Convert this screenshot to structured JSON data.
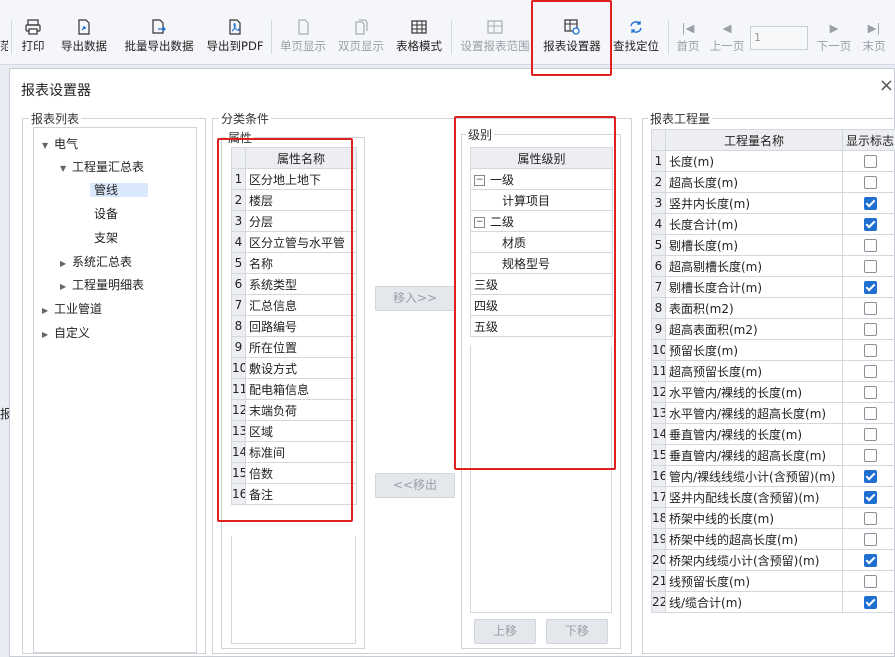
{
  "toolbar": {
    "partial_left": "范",
    "print": "打印",
    "export_data": "导出数据",
    "batch_export": "批量导出数据",
    "export_pdf": "导出到PDF",
    "single_page": "单页显示",
    "double_page": "双页显示",
    "table_mode": "表格模式",
    "set_range": "设置报表范围",
    "report_settings": "报表设置器",
    "find_locate": "查找定位",
    "first_page": "首页",
    "prev_page": "上一页",
    "page_value": "1",
    "next_page": "下一页",
    "last_page": "末页"
  },
  "dialog": {
    "title": "报表设置器",
    "close": "×",
    "side_char": "报"
  },
  "report_list": {
    "title": "报表列表",
    "nodes": [
      {
        "label": "电气"
      },
      {
        "label": "工程量汇总表"
      },
      {
        "label": "管线"
      },
      {
        "label": "设备"
      },
      {
        "label": "支架"
      },
      {
        "label": "系统汇总表"
      },
      {
        "label": "工程量明细表"
      },
      {
        "label": "工业管道"
      },
      {
        "label": "自定义"
      }
    ]
  },
  "classification": {
    "title": "分类条件",
    "attr_title": "属性",
    "attr_header": "属性名称",
    "attributes": [
      "区分地上地下",
      "楼层",
      "分层",
      "区分立管与水平管",
      "名称",
      "系统类型",
      "汇总信息",
      "回路编号",
      "所在位置",
      "敷设方式",
      "配电箱信息",
      "末端负荷",
      "区域",
      "标准间",
      "倍数",
      "备注"
    ],
    "move_in": "移入>>",
    "move_out": "<<移出",
    "level_title": "级别",
    "level_header": "属性级别",
    "levels": [
      {
        "label": "一级"
      },
      {
        "label": "计算项目"
      },
      {
        "label": "二级"
      },
      {
        "label": "材质"
      },
      {
        "label": "规格型号"
      },
      {
        "label": "三级"
      },
      {
        "label": "四级"
      },
      {
        "label": "五级"
      }
    ],
    "move_up": "上移",
    "move_down": "下移"
  },
  "quantities": {
    "title": "报表工程量",
    "col_name": "工程量名称",
    "col_show": "显示标志",
    "rows": [
      {
        "name": "长度(m)",
        "checked": false
      },
      {
        "name": "超高长度(m)",
        "checked": false
      },
      {
        "name": "竖井内长度(m)",
        "checked": true
      },
      {
        "name": "长度合计(m)",
        "checked": true
      },
      {
        "name": "剔槽长度(m)",
        "checked": false
      },
      {
        "name": "超高剔槽长度(m)",
        "checked": false
      },
      {
        "name": "剔槽长度合计(m)",
        "checked": true
      },
      {
        "name": "表面积(m2)",
        "checked": false
      },
      {
        "name": "超高表面积(m2)",
        "checked": false
      },
      {
        "name": "预留长度(m)",
        "checked": false
      },
      {
        "name": "超高预留长度(m)",
        "checked": false
      },
      {
        "name": "水平管内/裸线的长度(m)",
        "checked": false
      },
      {
        "name": "水平管内/裸线的超高长度(m)",
        "checked": false
      },
      {
        "name": "垂直管内/裸线的长度(m)",
        "checked": false
      },
      {
        "name": "垂直管内/裸线的超高长度(m)",
        "checked": false
      },
      {
        "name": "管内/裸线线缆小计(含预留)(m)",
        "checked": true
      },
      {
        "name": "竖井内配线长度(含预留)(m)",
        "checked": true
      },
      {
        "name": "桥架中线的长度(m)",
        "checked": false
      },
      {
        "name": "桥架中线的超高长度(m)",
        "checked": false
      },
      {
        "name": "桥架内线缆小计(含预留)(m)",
        "checked": true
      },
      {
        "name": "线预留长度(m)",
        "checked": false
      },
      {
        "name": "线/缆合计(m)",
        "checked": true
      }
    ]
  }
}
